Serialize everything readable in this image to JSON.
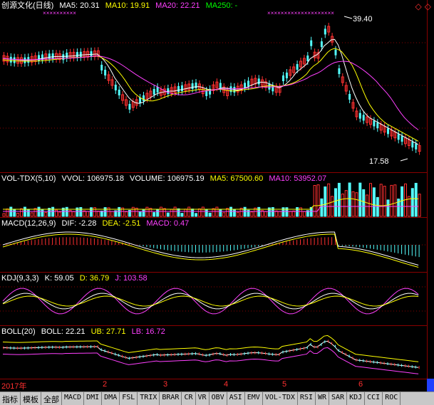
{
  "price_panel": {
    "title": "创源文化(日线)",
    "ma5": "MA5: 20.31",
    "ma10": "MA10: 19.91",
    "ma20": "MA20: 22.21",
    "ma250": "MA250: -",
    "high_label": "39.40",
    "low_label": "17.58"
  },
  "window_controls": {
    "restore": "◇",
    "close": "◇"
  },
  "vol_panel": {
    "name": "VOL-TDX(5,10)",
    "vvol": "VVOL: 106975.18",
    "volume": "VOLUME: 106975.19",
    "ma5": "MA5: 67500.60",
    "ma10": "MA10: 53952.07"
  },
  "macd_panel": {
    "name": "MACD(12,26,9)",
    "dif": "DIF: -2.28",
    "dea": "DEA: -2.51",
    "macd": "MACD: 0.47"
  },
  "kdj_panel": {
    "name": "KDJ(9,3,3)",
    "k": "K: 59.05",
    "d": "D: 36.79",
    "j": "J: 103.58"
  },
  "boll_panel": {
    "name": "BOLL(20)",
    "boll": "BOLL: 22.21",
    "ub": "UB: 27.71",
    "lb": "LB: 16.72"
  },
  "x_axis": {
    "labels": [
      "2017年",
      "2",
      "3",
      "4",
      "5",
      "6"
    ]
  },
  "tabs": [
    "指标",
    "模板",
    "全部",
    "MACD",
    "DMI",
    "DMA",
    "FSL",
    "TRIX",
    "BRAR",
    "CR",
    "VR",
    "OBV",
    "ASI",
    "EMV",
    "VOL-TDX",
    "RSI",
    "WR",
    "SAR",
    "KDJ",
    "CCI",
    "ROC"
  ],
  "colors": {
    "up": "#ff3030",
    "down": "#54fcfc",
    "ma5": "#ffffff",
    "ma10": "#ffff00",
    "ma20": "#ff40ff",
    "ma250": "#00ff00",
    "border": "#8a0000"
  }
}
